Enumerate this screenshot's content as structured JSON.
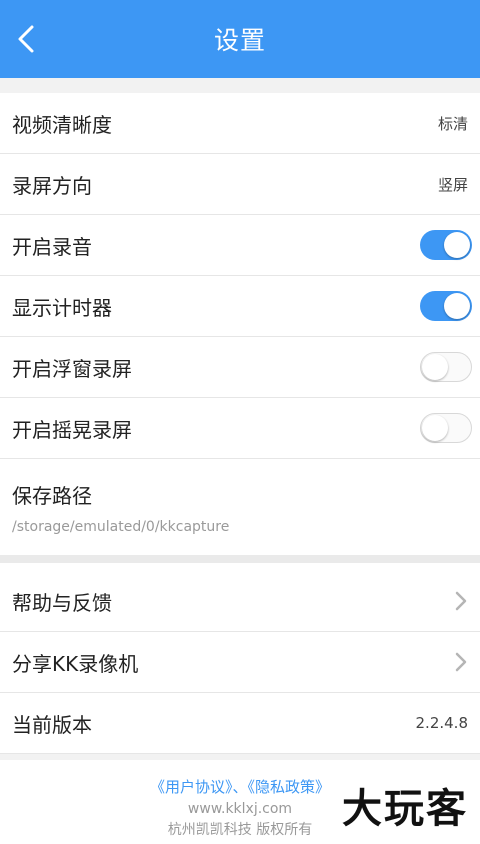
{
  "header": {
    "title": "设置"
  },
  "settings": {
    "video_quality": {
      "label": "视频清晰度",
      "value": "标清"
    },
    "orientation": {
      "label": "录屏方向",
      "value": "竖屏"
    },
    "record_audio": {
      "label": "开启录音",
      "enabled": true
    },
    "show_timer": {
      "label": "显示计时器",
      "enabled": true
    },
    "floating_window": {
      "label": "开启浮窗录屏",
      "enabled": false
    },
    "shake_record": {
      "label": "开启摇晃录屏",
      "enabled": false
    },
    "save_path": {
      "label": "保存路径",
      "value": "/storage/emulated/0/kkcapture"
    }
  },
  "more": {
    "help": {
      "label": "帮助与反馈"
    },
    "share": {
      "label": "分享KK录像机"
    },
    "version": {
      "label": "当前版本",
      "value": "2.2.4.8"
    }
  },
  "footer": {
    "user_agreement": "《用户协议》",
    "separator": "、",
    "privacy_policy": "《隐私政策》",
    "website": "www.kklxj.com",
    "copyright": "杭州凯凯科技 版权所有"
  },
  "watermark": "大玩客",
  "colors": {
    "accent": "#3d97f4"
  }
}
